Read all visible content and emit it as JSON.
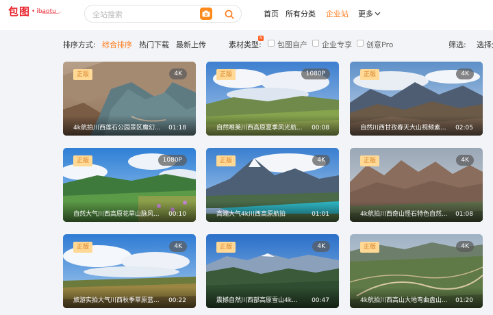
{
  "header": {
    "logo_main": "包图",
    "logo_dot": "•",
    "logo_sub": "ibaotu",
    "search_placeholder": "全站搜索",
    "nav": {
      "home": "首页",
      "categories": "所有分类",
      "enterprise": "企业站",
      "more": "更多"
    }
  },
  "filters": {
    "sort_label": "排序方式:",
    "sort_options": [
      "综合排序",
      "热门下载",
      "最新上传"
    ],
    "new_badge": "N",
    "type_label": "素材类型:",
    "type_options": [
      "包图自产",
      "企业专享",
      "创意Pro"
    ],
    "filter_label": "筛选:",
    "filter_cutoff": "选择分"
  },
  "cards": [
    {
      "badge": "正版",
      "res": "4K",
      "title": "4k航拍川西莲石公园景区魔幻...",
      "dur": "01:18"
    },
    {
      "badge": "正版",
      "res": "1080P",
      "title": "自然唯美川西高原夏季风光航...",
      "dur": "00:08"
    },
    {
      "badge": "正版",
      "res": "4K",
      "title": "自然川西甘孜春天大山视频素...",
      "dur": "02:05"
    },
    {
      "badge": "正版",
      "res": "1080P",
      "title": "自然大气川西高原花草山脉风...",
      "dur": "00:10"
    },
    {
      "badge": "正版",
      "res": "4K",
      "title": "高端大气4k川西高原航拍",
      "dur": "01:01"
    },
    {
      "badge": "正版",
      "res": "4K",
      "title": "4k航拍川西奇山怪石特色自然...",
      "dur": "01:08"
    },
    {
      "badge": "正版",
      "res": "4K",
      "title": "旅游实拍大气川西秋季草原蓝...",
      "dur": "00:22"
    },
    {
      "badge": "正版",
      "res": "4K",
      "title": "震撼自然川西部高原雪山4k...",
      "dur": "00:47"
    },
    {
      "badge": "正版",
      "res": "4K",
      "title": "4k航拍川西高山大地弯曲盘山...",
      "dur": "01:20"
    }
  ],
  "colors": {
    "accent": "#ff7a1a",
    "logo": "#e8212b",
    "badge_bg": "#ffd995",
    "badge_text": "#d7822a"
  },
  "icons": {
    "camera": "camera-icon",
    "search": "search-icon",
    "more": "chevron-down-icon"
  }
}
